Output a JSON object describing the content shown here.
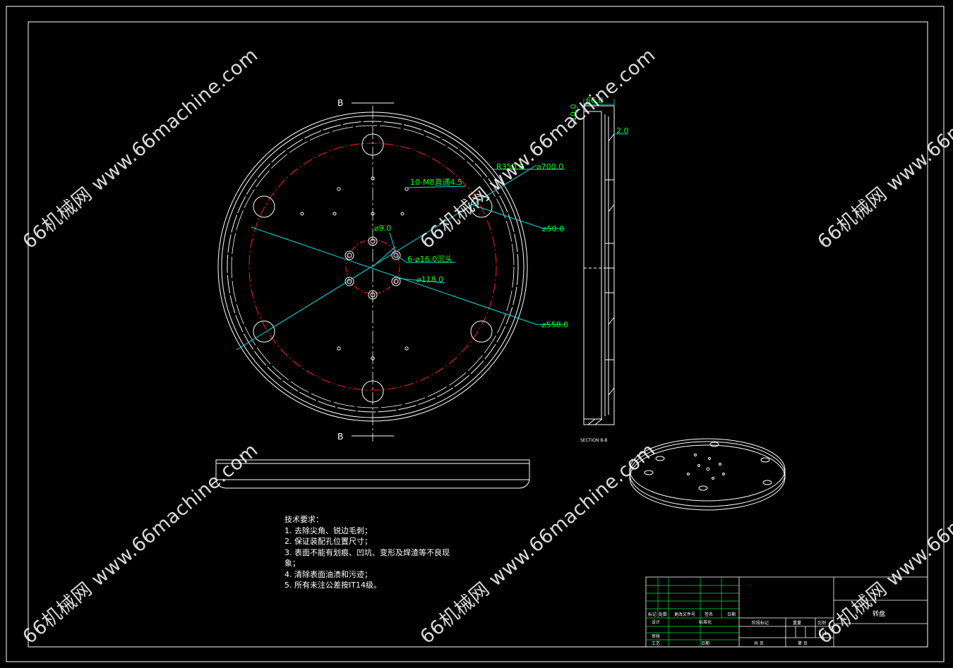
{
  "section_marks": {
    "top": "B",
    "bottom": "B",
    "section_caption": "SECTION B-B"
  },
  "dimensions": {
    "hole_note": "10-M8直通4.5",
    "r350": "R350.0",
    "d700": "⌀700.0",
    "d50": "⌀50.0",
    "d9": "⌀9.0",
    "counterbore": "6-⌀16.0沉头",
    "d118": "⌀118.0",
    "d558": "⌀558.0",
    "side_66": "66.0",
    "side_10": "10.0",
    "side_2": "2.0"
  },
  "technical_requirements": {
    "title": "技术要求：",
    "items": [
      "1. 去除尖角、锐边毛刺；",
      "2. 保证装配孔位置尺寸；",
      "3. 表面不能有划痕、凹坑、变形及焊渣等不良现",
      "象；",
      "4. 清除表面油渍和污迹；",
      "5. 所有未注公差按IT14级。"
    ]
  },
  "title_block": {
    "part_name": "转盘",
    "scale": "1:1",
    "labels": {
      "marker": "标记",
      "count": "处数",
      "zone": "分区",
      "change_doc": "更改文件号",
      "sign": "签名",
      "date": "日期",
      "designer": "设计",
      "standardize": "标准化",
      "stage_mark": "阶段标记",
      "weight": "重量",
      "ratio": "比例",
      "review": "审核",
      "process": "工艺",
      "approve": "日期",
      "sheets_total": "共  页",
      "sheet_no": "第  页"
    }
  },
  "watermark": "66机械网 www.66machine.com",
  "colors": {
    "background": "#000000",
    "lines": "#ffffff",
    "center_lines": "#ff2020",
    "dimension_lines": "#00e0e0",
    "dimension_text": "#00ff00"
  }
}
